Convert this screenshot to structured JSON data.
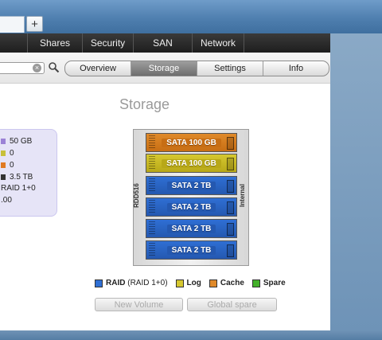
{
  "browser": {
    "new_tab_label": "+"
  },
  "topnav": {
    "items": [
      "Shares",
      "Security",
      "SAN",
      "Network"
    ]
  },
  "search": {
    "placeholder": "",
    "value": ""
  },
  "tabs": [
    {
      "label": "Overview",
      "active": false
    },
    {
      "label": "Storage",
      "active": true
    },
    {
      "label": "Settings",
      "active": false
    },
    {
      "label": "Info",
      "active": false
    }
  ],
  "page_title": "Storage",
  "summary": {
    "rows": [
      {
        "text": "50 GB",
        "color": "#9b82d6"
      },
      {
        "text": "0",
        "color": "#c8c03a"
      },
      {
        "text": "0",
        "color": "#e07a22"
      },
      {
        "text": "3.5 TB",
        "color": "#333333"
      },
      {
        "text": "RAID 1+0",
        "color": ""
      },
      {
        "text": ".00",
        "color": ""
      }
    ]
  },
  "enclosure": {
    "left_label": "RDD516",
    "right_label": "Internal",
    "slots": [
      {
        "label": "SATA 100 GB",
        "type": "cache",
        "color": "#e08a2a",
        "label_bg": "#c76e14"
      },
      {
        "label": "SATA 100 GB",
        "type": "log",
        "color": "#d6c830",
        "label_bg": "#b8a818"
      },
      {
        "label": "SATA 2 TB",
        "type": "raid",
        "color": "#2f6fd4",
        "label_bg": "#2458b0"
      },
      {
        "label": "SATA 2 TB",
        "type": "raid",
        "color": "#2f6fd4",
        "label_bg": "#2458b0"
      },
      {
        "label": "SATA 2 TB",
        "type": "raid",
        "color": "#2f6fd4",
        "label_bg": "#2458b0"
      },
      {
        "label": "SATA 2 TB",
        "type": "raid",
        "color": "#2f6fd4",
        "label_bg": "#2458b0"
      }
    ]
  },
  "legend": {
    "raid_label": "RAID",
    "raid_detail": "(RAID 1+0)",
    "log_label": "Log",
    "cache_label": "Cache",
    "spare_label": "Spare",
    "colors": {
      "raid": "#2f6fd4",
      "log": "#d6c830",
      "cache": "#e08a2a",
      "spare": "#43b02a"
    }
  },
  "buttons": {
    "new_volume": "New Volume",
    "global_spare": "Global spare"
  }
}
